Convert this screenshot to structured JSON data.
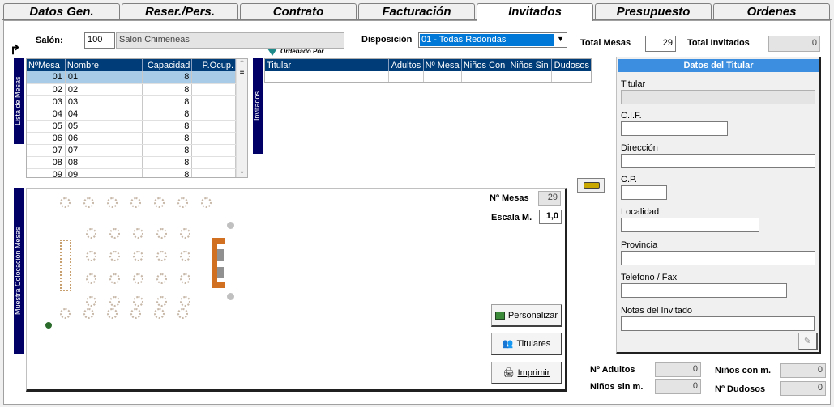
{
  "tabs": [
    "Datos Gen.",
    "Reser./Pers.",
    "Contrato",
    "Facturación",
    "Invitados",
    "Presupuesto",
    "Ordenes"
  ],
  "active_tab": "Invitados",
  "header": {
    "salon_label": "Salón:",
    "salon_code": "100",
    "salon_name": "Salon Chimeneas",
    "disposicion_label": "Disposición",
    "disposicion_value": "01 - Todas Redondas",
    "total_mesas_label": "Total Mesas",
    "total_mesas_value": "29",
    "total_invitados_label": "Total Invitados",
    "total_invitados_value": "0",
    "ordenado_por": "Ordenado Por"
  },
  "side_tabs": {
    "lista": "Lista de Mesas",
    "invitados": "Invitados",
    "muestra": "Muestra Colocación Mesas"
  },
  "mesas_table": {
    "columns": [
      "NºMesa",
      "Nombre",
      "Capacidad",
      "P.Ocup."
    ],
    "rows": [
      [
        "01",
        "01",
        "8",
        ""
      ],
      [
        "02",
        "02",
        "8",
        ""
      ],
      [
        "03",
        "03",
        "8",
        ""
      ],
      [
        "04",
        "04",
        "8",
        ""
      ],
      [
        "05",
        "05",
        "8",
        ""
      ],
      [
        "06",
        "06",
        "8",
        ""
      ],
      [
        "07",
        "07",
        "8",
        ""
      ],
      [
        "08",
        "08",
        "8",
        ""
      ],
      [
        "09",
        "09",
        "8",
        ""
      ]
    ]
  },
  "invitados_table": {
    "columns": [
      "Titular",
      "Adultos",
      "Nº Mesa",
      "Niños Con",
      "Niños Sin",
      "Dudosos"
    ]
  },
  "layout_panel": {
    "num_mesas_label": "Nº Mesas",
    "num_mesas_value": "29",
    "escala_label": "Escala M.",
    "escala_value": "1,0",
    "btn_personalizar": "Personalizar",
    "btn_titulares": "Titulares",
    "btn_imprimir": "Imprimir"
  },
  "titular": {
    "header": "Datos del Titular",
    "titular_label": "Titular",
    "cif_label": "C.I.F.",
    "direccion_label": "Dirección",
    "cp_label": "C.P.",
    "localidad_label": "Localidad",
    "provincia_label": "Provincia",
    "telefono_label": "Telefono / Fax",
    "notas_label": "Notas del Invitado"
  },
  "totals": {
    "adultos_label": "Nº Adultos",
    "adultos_value": "0",
    "ninos_sin_label": "Niños sin m.",
    "ninos_sin_value": "0",
    "ninos_con_label": "Niños con m.",
    "ninos_con_value": "0",
    "dudosos_label": "Nº Dudosos",
    "dudosos_value": "0"
  }
}
